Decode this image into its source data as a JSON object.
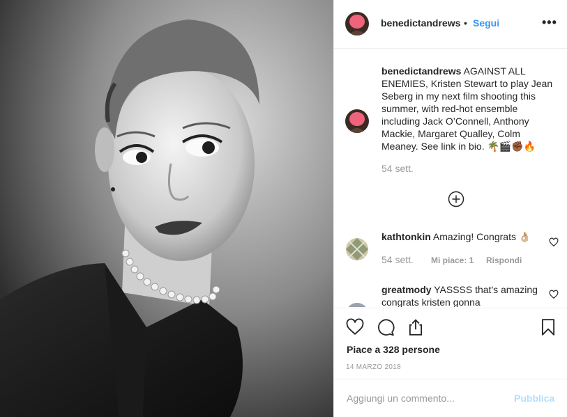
{
  "post": {
    "username": "benedictandrews",
    "separator": "•",
    "follow_label": "Segui",
    "more_icon": "more-horizontal-icon"
  },
  "caption": {
    "username": "benedictandrews",
    "text": " AGAINST ALL ENEMIES, Kristen Stewart to play Jean Seberg in my next film shooting this summer, with red-hot ensemble including Jack O’Connell, Anthony Mackie, Margaret Qualley, Colm Meaney. See link in bio. 🌴🎬✊🏾🔥",
    "time": "54 sett."
  },
  "load_more_icon": "plus-circle-icon",
  "comments": [
    {
      "username": "kathtonkin",
      "text": " Amazing! Congrats 👌🏼",
      "time": "54 sett.",
      "likes": "Mi piace: 1",
      "reply": "Rispondi"
    },
    {
      "username": "greatmody",
      "text": " YASSSS that's amazing congrats kristen gonna"
    }
  ],
  "actions": {
    "likes": "Piace a 328 persone",
    "date": "14 MARZO 2018"
  },
  "add_comment": {
    "placeholder": "Aggiungi un commento...",
    "publish_label": "Pubblica"
  },
  "colors": {
    "link": "#3897f0",
    "muted": "#999999",
    "publish_disabled": "#b2dffc",
    "text": "#262626",
    "divider": "#efefef"
  }
}
